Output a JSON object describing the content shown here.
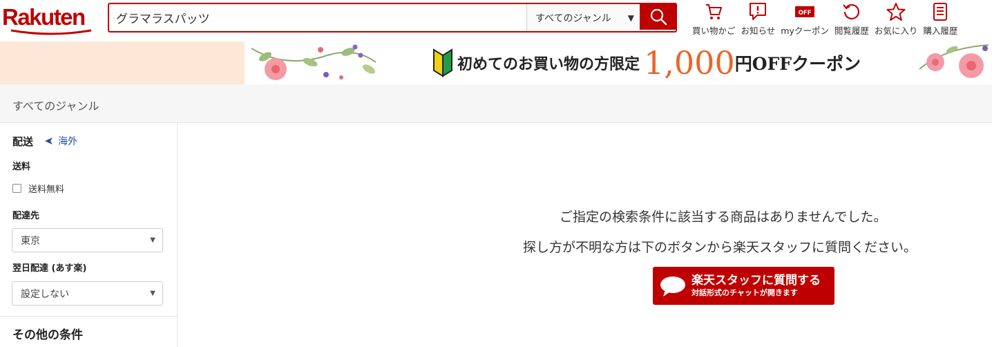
{
  "header": {
    "logo": "Rakuten",
    "search": {
      "value": "グラマラスパッツ",
      "placeholder": ""
    },
    "genre_select": "すべてのジャンル",
    "nav": [
      {
        "label": "買い物かご",
        "icon": "cart-icon"
      },
      {
        "label": "お知らせ",
        "icon": "notification-icon"
      },
      {
        "label": "myクーポン",
        "icon": "coupon-icon"
      },
      {
        "label": "閲覧履歴",
        "icon": "history-icon"
      },
      {
        "label": "お気に入り",
        "icon": "star-icon"
      },
      {
        "label": "購入履歴",
        "icon": "receipt-icon"
      }
    ],
    "coupon_icon_text": "OFF",
    "brand_color": "#bf0000"
  },
  "banner": {
    "lead": "初めてのお買い物の方限定",
    "amount": "1,000",
    "tail": "円OFFクーポン",
    "amount_color": "#e8662b"
  },
  "breadcrumb": "すべてのジャンル",
  "sidebar": {
    "shipping_heading": "配送",
    "overseas_link": "海外",
    "shipping_fee_label": "送料",
    "free_shipping_label": "送料無料",
    "destination_label": "配達先",
    "destination_value": "東京",
    "next_day_label": "翌日配達 (あす楽)",
    "next_day_value": "設定しない",
    "other_conditions": "その他の条件"
  },
  "main": {
    "no_results": "ご指定の検索条件に該当する商品はありませんでした。",
    "help_text": "探し方が不明な方は下のボタンから楽天スタッフに質問ください。",
    "chat_button": {
      "main": "楽天スタッフに質問する",
      "sub": "対話形式のチャットが開きます"
    }
  }
}
